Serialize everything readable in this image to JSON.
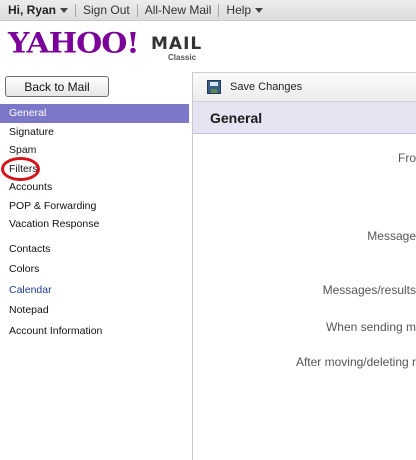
{
  "topbar": {
    "greeting": "Hi, Ryan",
    "sign_out": "Sign Out",
    "all_new_mail": "All-New Mail",
    "help": "Help"
  },
  "logo": {
    "brand": "YAHOO!",
    "product": "MAIL",
    "edition": "Classic",
    "brand_color": "#7b0099"
  },
  "sidebar": {
    "back_button": "Back to Mail",
    "items": [
      {
        "label": "General",
        "selected": true
      },
      {
        "label": "Signature"
      },
      {
        "label": "Spam"
      },
      {
        "label": "Filters",
        "annotated": true
      },
      {
        "label": "Accounts"
      },
      {
        "label": "POP & Forwarding"
      },
      {
        "label": "Vacation Response"
      }
    ],
    "items2": [
      {
        "label": "Contacts"
      },
      {
        "label": "Colors"
      },
      {
        "label": "Calendar"
      },
      {
        "label": "Notepad"
      },
      {
        "label": "Account Information"
      }
    ]
  },
  "toolbar": {
    "save_label": "Save Changes"
  },
  "section": {
    "title": "General"
  },
  "fields": [
    "Fro",
    "Message",
    "Messages/results",
    "When sending m",
    "After moving/deleting r"
  ],
  "colors": {
    "selected_bg": "#7c77c8",
    "section_bg": "#e4e4f2",
    "annotation_ring": "#d4141a"
  }
}
